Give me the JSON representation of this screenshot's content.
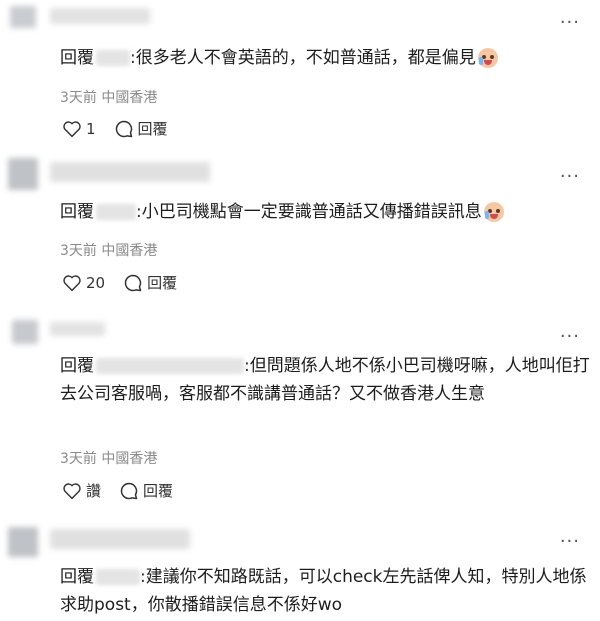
{
  "comments": [
    {
      "reply_prefix": "回覆",
      "text": ":很多老人不會英語的，不如普通話，都是偏見",
      "meta": "3天前 中國香港",
      "likes": "1",
      "reply_label": "回覆"
    },
    {
      "reply_prefix": "回覆",
      "text": ":小巴司機點會一定要識普通話又傳播錯誤訊息",
      "meta": "3天前 中國香港",
      "likes": "20",
      "reply_label": "回覆"
    },
    {
      "reply_prefix": "回覆",
      "text": ":但問題係人地不係小巴司機呀嘛，人地叫佢打去公司客服喎，客服都不識講普通話？又不做香港人生意",
      "meta": "3天前 中國香港",
      "likes": "讚",
      "reply_label": "回覆"
    },
    {
      "reply_prefix": "回覆",
      "text": ":建議你不知路既話，可以check左先話俾人知，特別人地係求助post，你散播錯誤信息不係好wo"
    }
  ],
  "more_icon": "more-horizontal-icon",
  "like_icon": "heart-icon",
  "comment_icon": "comment-bubble-icon",
  "emoji_icon": "crying-laughing-emoji-icon"
}
